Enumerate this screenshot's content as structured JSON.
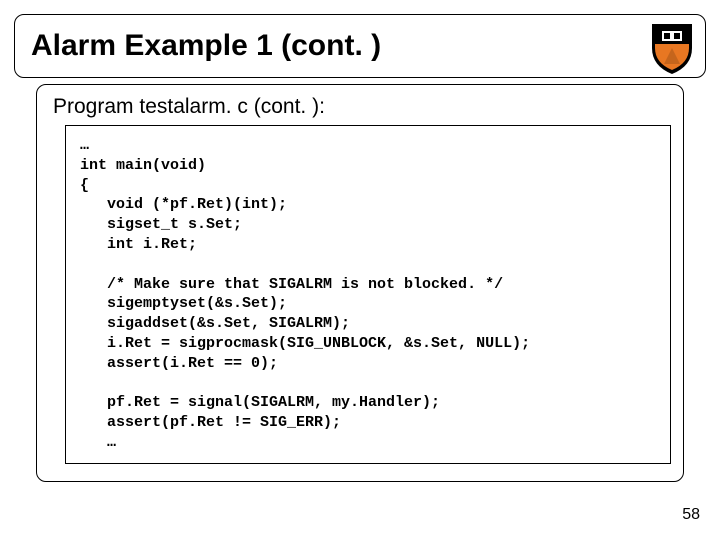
{
  "title": "Alarm Example 1 (cont. )",
  "program_label": "Program testalarm. c (cont. ):",
  "code": "…\nint main(void)\n{\n   void (*pf.Ret)(int);\n   sigset_t s.Set;\n   int i.Ret;\n\n   /* Make sure that SIGALRM is not blocked. */\n   sigemptyset(&s.Set);\n   sigaddset(&s.Set, SIGALRM);\n   i.Ret = sigprocmask(SIG_UNBLOCK, &s.Set, NULL);\n   assert(i.Ret == 0);\n\n   pf.Ret = signal(SIGALRM, my.Handler);\n   assert(pf.Ret != SIG_ERR);\n   …",
  "page_number": "58"
}
